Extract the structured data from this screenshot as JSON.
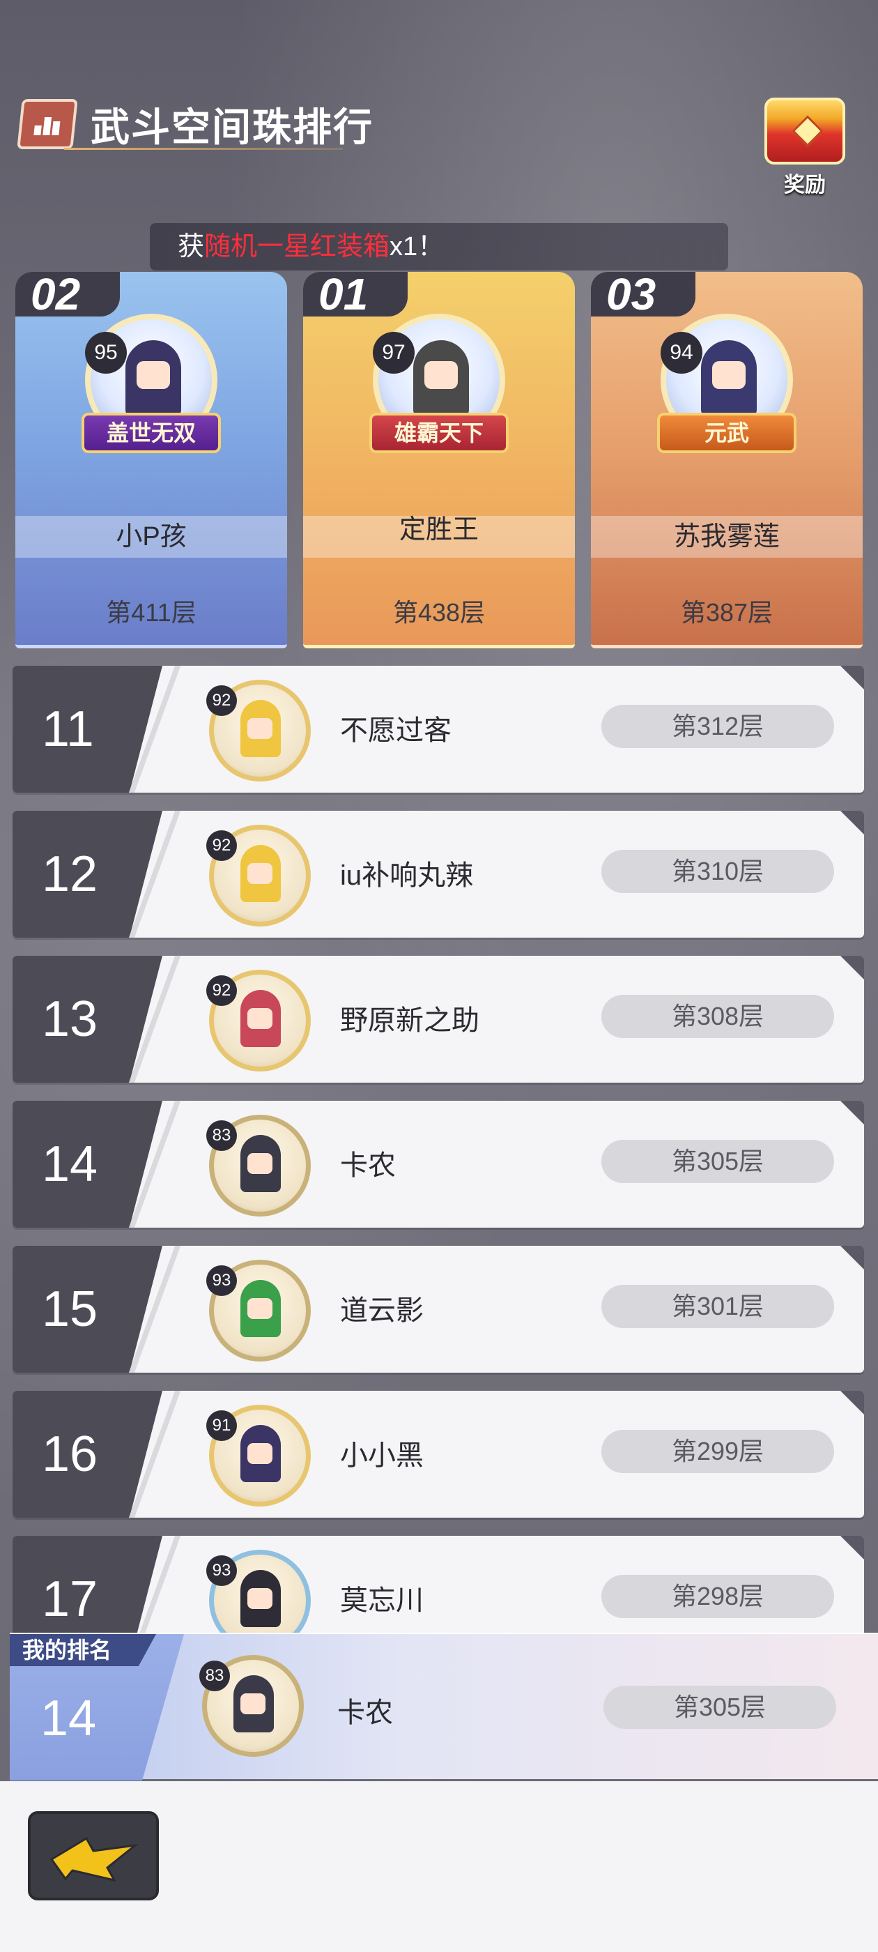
{
  "header": {
    "title": "武斗空间珠排行"
  },
  "reward": {
    "label": "奖励"
  },
  "ticker": {
    "prefix": "获",
    "highlight": "随机一星红装箱",
    "suffix": "x1！"
  },
  "podium": [
    {
      "rank": "02",
      "level": "95",
      "title_badge": "盖世无双",
      "name": "小P孩",
      "floor": "第411层"
    },
    {
      "rank": "01",
      "level": "97",
      "title_badge": "雄霸天下",
      "name": "定胜王",
      "floor": "第438层"
    },
    {
      "rank": "03",
      "level": "94",
      "title_badge": "元武",
      "name": "苏我雾莲",
      "floor": "第387层"
    }
  ],
  "ranking": [
    {
      "rank": "11",
      "level": "92",
      "name": "不愿过客",
      "floor": "第312层"
    },
    {
      "rank": "12",
      "level": "92",
      "name": "iu补响丸辣",
      "floor": "第310层"
    },
    {
      "rank": "13",
      "level": "92",
      "name": "野原新之助",
      "floor": "第308层"
    },
    {
      "rank": "14",
      "level": "83",
      "name": "卡农",
      "floor": "第305层"
    },
    {
      "rank": "15",
      "level": "93",
      "name": "道云影",
      "floor": "第301层"
    },
    {
      "rank": "16",
      "level": "91",
      "name": "小小黑",
      "floor": "第299层"
    },
    {
      "rank": "17",
      "level": "93",
      "name": "莫忘川",
      "floor": "第298层"
    }
  ],
  "my_rank": {
    "tag": "我的排名",
    "rank": "14",
    "level": "83",
    "name": "卡农",
    "floor": "第305层"
  },
  "colors": {
    "accent_red": "#ff2e3c",
    "row_dark": "#4c4b56",
    "gold": "#e7c66f"
  }
}
